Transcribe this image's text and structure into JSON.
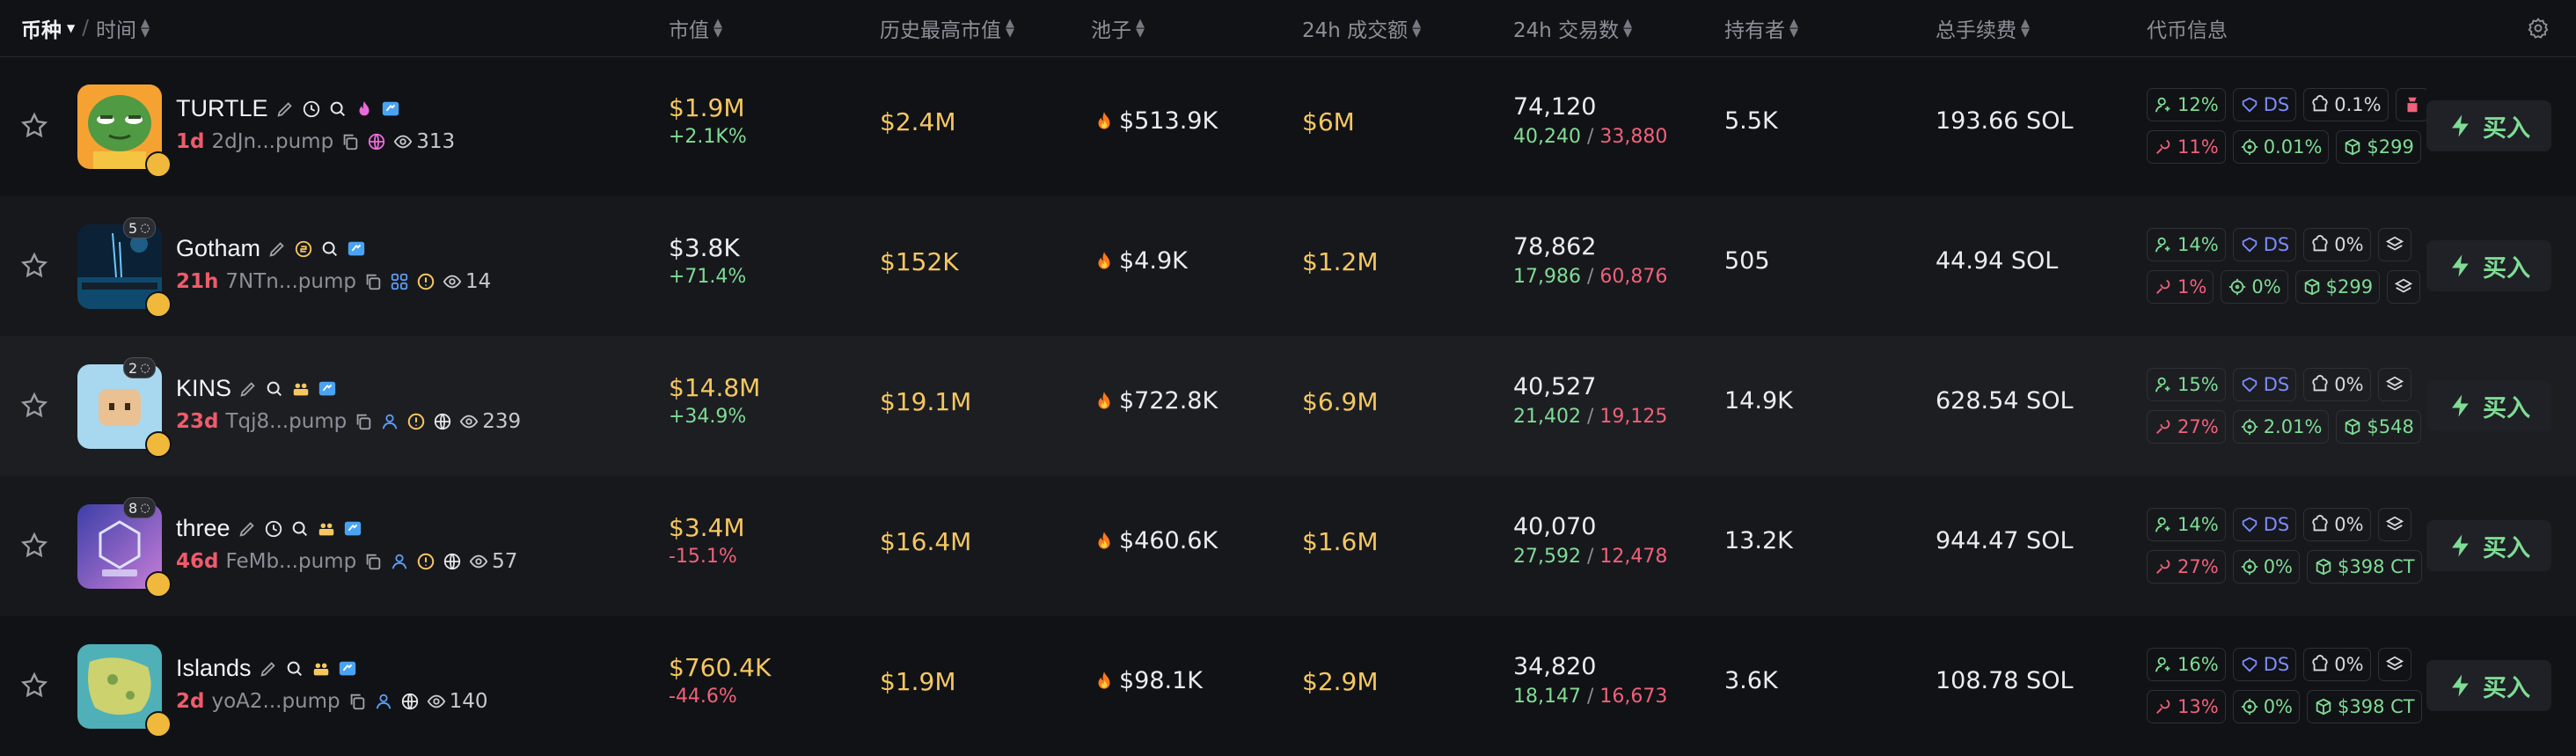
{
  "header": {
    "col_token": "币种",
    "col_time": "时间",
    "col_mcap": "市值",
    "col_ath": "历史最高市值",
    "col_pool": "池子",
    "col_vol": "24h 成交额",
    "col_tx": "24h 交易数",
    "col_holders": "持有者",
    "col_fees": "总手续费",
    "col_info": "代币信息"
  },
  "rows": [
    {
      "name": "TURTLE",
      "age": "1d",
      "address": "2dJn...pump",
      "watchers": "313",
      "sub_count": "",
      "mcap": "$1.9M",
      "mcap_change": "+2.1K%",
      "ath": "$2.4M",
      "pool": "$513.9K",
      "volume": "$6M",
      "tx_total": "74,120",
      "tx_buy": "40,240",
      "tx_sell": "33,880",
      "holders": "5.5K",
      "fees": "193.66 SOL",
      "chips_top": [
        "12%",
        "DS",
        "0.1%",
        ""
      ],
      "chips_bottom": [
        "11%",
        "0.01%",
        "$299"
      ],
      "buy_label": "买入"
    },
    {
      "name": "Gotham",
      "age": "21h",
      "address": "7NTn...pump",
      "watchers": "14",
      "sub_count": "5",
      "mcap": "$3.8K",
      "mcap_change": "+71.4%",
      "ath": "$152K",
      "pool": "$4.9K",
      "volume": "$1.2M",
      "tx_total": "78,862",
      "tx_buy": "17,986",
      "tx_sell": "60,876",
      "holders": "505",
      "fees": "44.94 SOL",
      "chips_top": [
        "14%",
        "DS",
        "0%",
        ""
      ],
      "chips_bottom": [
        "1%",
        "0%",
        "$299"
      ],
      "buy_label": "买入"
    },
    {
      "name": "KINS",
      "age": "23d",
      "address": "Tqj8...pump",
      "watchers": "239",
      "sub_count": "2",
      "mcap": "$14.8M",
      "mcap_change": "+34.9%",
      "ath": "$19.1M",
      "pool": "$722.8K",
      "volume": "$6.9M",
      "tx_total": "40,527",
      "tx_buy": "21,402",
      "tx_sell": "19,125",
      "holders": "14.9K",
      "fees": "628.54 SOL",
      "chips_top": [
        "15%",
        "DS",
        "0%",
        ""
      ],
      "chips_bottom": [
        "27%",
        "2.01%",
        "$548"
      ],
      "buy_label": "买入"
    },
    {
      "name": "three",
      "age": "46d",
      "address": "FeMb...pump",
      "watchers": "57",
      "sub_count": "8",
      "mcap": "$3.4M",
      "mcap_change": "-15.1%",
      "ath": "$16.4M",
      "pool": "$460.6K",
      "volume": "$1.6M",
      "tx_total": "40,070",
      "tx_buy": "27,592",
      "tx_sell": "12,478",
      "holders": "13.2K",
      "fees": "944.47 SOL",
      "chips_top": [
        "14%",
        "DS",
        "0%",
        ""
      ],
      "chips_bottom": [
        "27%",
        "0%",
        "$398 CT"
      ],
      "buy_label": "买入"
    },
    {
      "name": "Islands",
      "age": "2d",
      "address": "yoA2...pump",
      "watchers": "140",
      "sub_count": "",
      "mcap": "$760.4K",
      "mcap_change": "-44.6%",
      "ath": "$1.9M",
      "pool": "$98.1K",
      "volume": "$2.9M",
      "tx_total": "34,820",
      "tx_buy": "18,147",
      "tx_sell": "16,673",
      "holders": "3.6K",
      "fees": "108.78 SOL",
      "chips_top": [
        "16%",
        "DS",
        "0%",
        ""
      ],
      "chips_bottom": [
        "13%",
        "0%",
        "$398 CT"
      ],
      "buy_label": "买入"
    }
  ],
  "colors": {
    "yellow": "#f5c761",
    "green": "#7fdc95",
    "red": "#f0617a",
    "blue": "#7c8cff",
    "accent_badge": "#f0b93b"
  },
  "icons": [
    "star-icon",
    "edit-icon",
    "clock-icon",
    "search-icon",
    "fire-icon",
    "twitter-icon",
    "copy-icon",
    "globe-icon",
    "eye-icon",
    "user-icon",
    "group-icon",
    "warning-icon",
    "gear-icon",
    "lightning-icon",
    "dev-icon",
    "crosshair-icon",
    "shield-icon",
    "layers-icon"
  ]
}
